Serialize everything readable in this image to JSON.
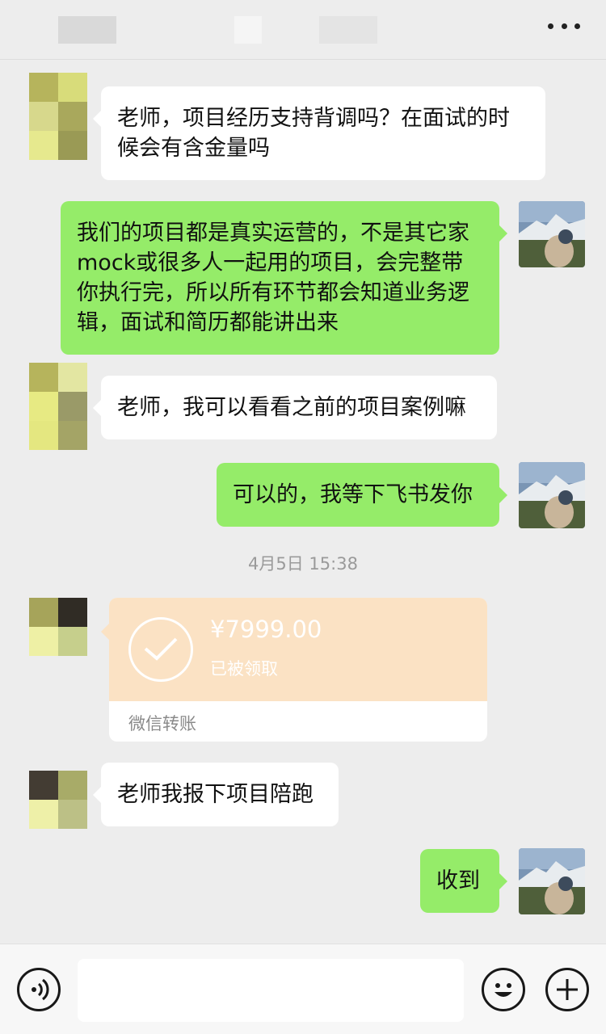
{
  "header": {
    "title": "",
    "more_icon": "more-dots-icon"
  },
  "messages": [
    {
      "side": "left",
      "text": "老师，项目经历支持背调吗？在面试的时候会有含金量吗"
    },
    {
      "side": "right",
      "text": "我们的项目都是真实运营的，不是其它家mock或很多人一起用的项目，会完整带你执行完，所以所有环节都会知道业务逻辑，面试和简历都能讲出来"
    },
    {
      "side": "left",
      "text": "老师，我可以看看之前的项目案例嘛"
    },
    {
      "side": "right",
      "text": "可以的，我等下飞书发你"
    },
    {
      "side": "left",
      "text": "老师我报下项目陪跑"
    },
    {
      "side": "right",
      "text": "收到"
    }
  ],
  "timestamp": "4月5日 15:38",
  "transfer": {
    "amount": "¥7999.00",
    "status": "已被领取",
    "label": "微信转账",
    "icon": "check-circle-icon"
  },
  "input_bar": {
    "voice_icon": "voice-icon",
    "emoji_icon": "emoji-icon",
    "plus_icon": "plus-icon",
    "placeholder": ""
  },
  "colors": {
    "background": "#ededed",
    "bubble_right": "#95ec69",
    "bubble_left": "#ffffff",
    "transfer_bg": "#fbe2c4"
  }
}
